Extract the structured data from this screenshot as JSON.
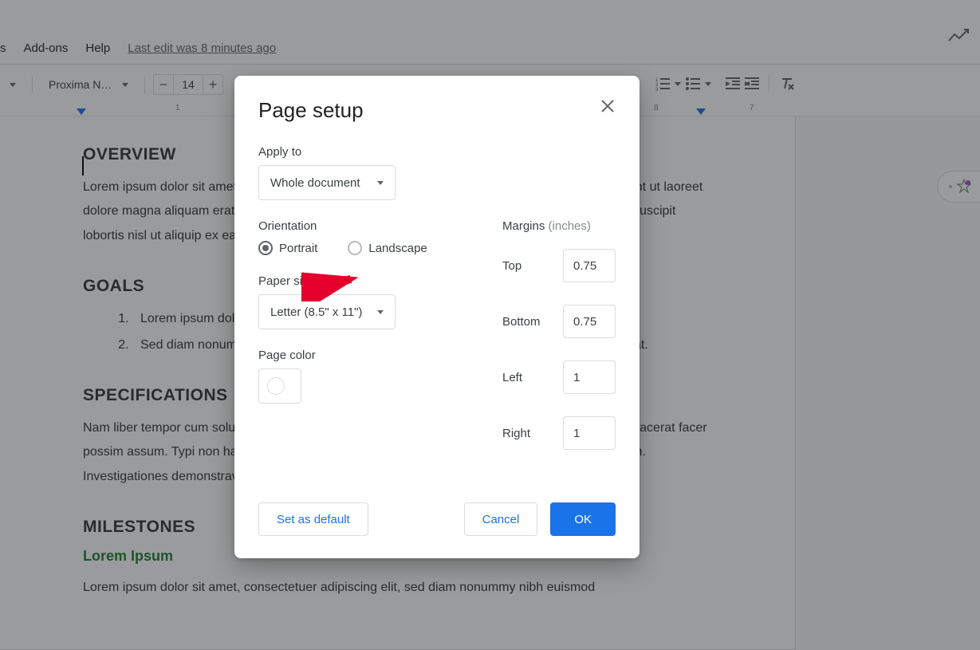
{
  "menubar": {
    "items": [
      "s",
      "Add-ons",
      "Help"
    ],
    "last_edit": "Last edit was 8 minutes ago"
  },
  "toolbar": {
    "font_name": "Proxima N…",
    "font_size": "14"
  },
  "ruler": {
    "marks": [
      "1",
      "8",
      "7"
    ]
  },
  "document": {
    "h_overview": "OVERVIEW",
    "p_overview": "Lorem ipsum dolor sit amet, consectetuer adipiscing elit, sed diam nonummy nibh euismod tincidunt ut laoreet dolore magna aliquam erat. Ut wisi enim ad minim veniam, quis nostrud exerci tation ullamcorper suscipit lobortis nisl ut aliquip ex ea commodo consequat.",
    "h_goals": "GOALS",
    "goals": [
      "Lorem ipsum dolor sit amet, consectetuer adipiscing elit.",
      "Sed diam nonummy nibh euismod tincidunt ut laoreet dolore magna aliquam erat volutpat."
    ],
    "h_specs": "SPECIFICATIONS",
    "p_specs": "Nam liber tempor cum soluta nobis eleifend option congue nihil imperdiet doming id quod mazim placerat facer possim assum. Typi non habent claritatem insitam; est usus legentis in iis qui facit eorum claritatem. Investigationes demonstraverunt lectores legere me lius quod ii legunt saepius.",
    "h_milestones": "MILESTONES",
    "link_lorem": "Lorem Ipsum",
    "p_bottom": "Lorem ipsum dolor sit amet, consectetuer adipiscing elit, sed diam nonummy nibh euismod"
  },
  "dialog": {
    "title": "Page setup",
    "apply_to_label": "Apply to",
    "apply_to_value": "Whole document",
    "orientation_label": "Orientation",
    "portrait": "Portrait",
    "landscape": "Landscape",
    "paper_size_label": "Paper size",
    "paper_size_value": "Letter (8.5\" x 11\")",
    "page_color_label": "Page color",
    "margins_label": "Margins",
    "margins_hint": "(inches)",
    "margins": {
      "top_label": "Top",
      "top": "0.75",
      "bottom_label": "Bottom",
      "bottom": "0.75",
      "left_label": "Left",
      "left": "1",
      "right_label": "Right",
      "right": "1"
    },
    "set_default": "Set as default",
    "cancel": "Cancel",
    "ok": "OK"
  }
}
